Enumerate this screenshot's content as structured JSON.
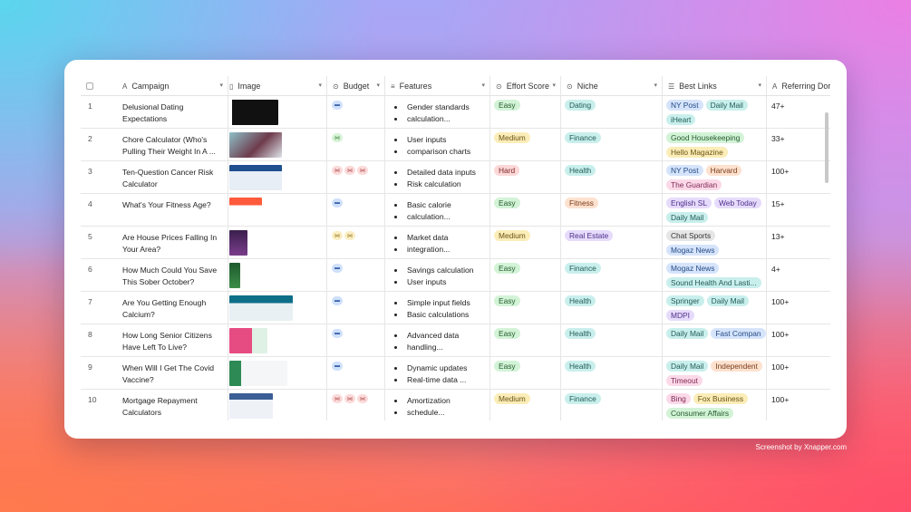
{
  "credit": "Screenshot by Xnapper.com",
  "columns": {
    "campaign": "Campaign",
    "image": "Image",
    "budget": "Budget",
    "features": "Features",
    "effort": "Effort Score",
    "niche": "Niche",
    "links": "Best Links",
    "ref": "Referring Dor"
  },
  "icons": {
    "campaign": "text-type-icon",
    "image": "attachment-icon",
    "budget": "single-select-icon",
    "features": "long-text-icon",
    "effort": "single-select-icon",
    "niche": "single-select-icon",
    "links": "multi-select-icon",
    "ref": "text-type-icon"
  },
  "rows": [
    {
      "n": "1",
      "c1": "Delusional Dating",
      "c2": "Expectations",
      "budget": [
        "blue"
      ],
      "f1": "Gender standards",
      "f2": "calculation...",
      "effort": "Easy",
      "niche": "Dating",
      "links": [
        "NY Post",
        "Daily Mail",
        "iHeart"
      ],
      "ref": "47+"
    },
    {
      "n": "2",
      "c1": "Chore Calculator (Who's",
      "c2": "Pulling Their Weight In A ...",
      "budget": [
        "green"
      ],
      "f1": "User inputs",
      "f2": "comparison charts",
      "effort": "Medium",
      "niche": "Finance",
      "links": [
        "Good Housekeeping",
        "Hello Magazine"
      ],
      "ref": "33+"
    },
    {
      "n": "3",
      "c1": "Ten-Question Cancer Risk",
      "c2": "Calculator",
      "budget": [
        "pink",
        "pink",
        "pink"
      ],
      "f1": "Detailed data inputs",
      "f2": "Risk calculation",
      "effort": "Hard",
      "niche": "Health",
      "links": [
        "NY Post",
        "Harvard",
        "The Guardian"
      ],
      "ref": "100+"
    },
    {
      "n": "4",
      "c1": "What's Your Fitness Age?",
      "c2": "",
      "budget": [
        "blue"
      ],
      "f1": "Basic calorie",
      "f2": "calculation...",
      "effort": "Easy",
      "niche": "Fitness",
      "links": [
        "English SL",
        "Web Today",
        "Daily Mail"
      ],
      "ref": "15+"
    },
    {
      "n": "5",
      "c1": "Are House Prices Falling In",
      "c2": "Your Area?",
      "budget": [
        "yellow",
        "yellow"
      ],
      "f1": "Market data",
      "f2": "integration...",
      "effort": "Medium",
      "niche": "Real Estate",
      "links": [
        "Chat Sports",
        "Mogaz News"
      ],
      "ref": "13+"
    },
    {
      "n": "6",
      "c1": "How Much Could You Save",
      "c2": "This Sober October?",
      "budget": [
        "blue"
      ],
      "f1": "Savings calculation",
      "f2": "User inputs",
      "effort": "Easy",
      "niche": "Finance",
      "links": [
        "Mogaz News",
        "Sound Health And Lasti..."
      ],
      "ref": "4+"
    },
    {
      "n": "7",
      "c1": "Are You Getting Enough",
      "c2": "Calcium?",
      "budget": [
        "blue"
      ],
      "f1": "Simple input fields",
      "f2": "Basic calculations",
      "effort": "Easy",
      "niche": "Health",
      "links": [
        "Springer",
        "Daily Mail",
        "MDPI"
      ],
      "ref": "100+"
    },
    {
      "n": "8",
      "c1": "How Long Senior Citizens",
      "c2": "Have Left To Live?",
      "budget": [
        "blue"
      ],
      "f1": "Advanced data",
      "f2": "handling...",
      "effort": "Easy",
      "niche": "Health",
      "links": [
        "Daily Mail",
        "Fast Compan"
      ],
      "ref": "100+"
    },
    {
      "n": "9",
      "c1": "When Will I Get The Covid",
      "c2": "Vaccine?",
      "budget": [
        "blue"
      ],
      "f1": "Dynamic updates",
      "f2": "Real-time data ...",
      "effort": "Easy",
      "niche": "Health",
      "links": [
        "Daily Mail",
        "Independent",
        "Timeout"
      ],
      "ref": "100+"
    },
    {
      "n": "10",
      "c1": "Mortgage Repayment",
      "c2": "Calculators",
      "budget": [
        "pink",
        "pink",
        "pink"
      ],
      "f1": "Amortization",
      "f2": "schedule...",
      "effort": "Medium",
      "niche": "Finance",
      "links": [
        "Bing",
        "Fox Business",
        "Consumer Affairs"
      ],
      "ref": "100+"
    }
  ],
  "colors": {
    "effort": {
      "Easy": "green",
      "Medium": "yellow",
      "Hard": "red"
    },
    "niche": {
      "Dating": "teal",
      "Finance": "teal",
      "Health": "teal",
      "Fitness": "orange",
      "Real Estate": "purple"
    },
    "links": {
      "NY Post": "blue",
      "Daily Mail": "teal",
      "iHeart": "teal",
      "Good Housekeeping": "green",
      "Hello Magazine": "yellow",
      "Harvard": "orange",
      "The Guardian": "pink",
      "English SL": "purple",
      "Web Today": "purple",
      "Chat Sports": "gray",
      "Mogaz News": "blue",
      "Sound Health And Lasti...": "teal",
      "Springer": "teal",
      "MDPI": "purple",
      "Fast Compan": "blue",
      "Independent": "orange",
      "Timeout": "pink",
      "Bing": "pink",
      "Fox Business": "yellow",
      "Consumer Affairs": "green"
    }
  }
}
